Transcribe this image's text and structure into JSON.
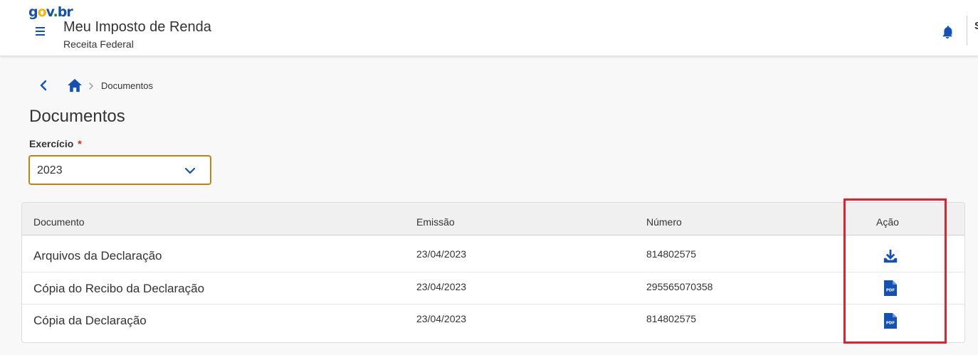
{
  "header": {
    "logo": {
      "g": "g",
      "o": "o",
      "v": "v",
      "dot": ".",
      "br": "br"
    },
    "title": "Meu Imposto de Renda",
    "subtitle": "Receita Federal",
    "cut_text": "S",
    "icons": {
      "menu": "hamburger-menu-icon",
      "notifications": "bell-icon"
    }
  },
  "breadcrumb": {
    "current": "Documentos",
    "icons": {
      "back": "chevron-left-icon",
      "home": "home-icon",
      "separator": "chevron-right-icon"
    }
  },
  "page": {
    "title": "Documentos"
  },
  "form": {
    "exercicio_label": "Exercício",
    "required_mark": "*",
    "exercicio_value": "2023"
  },
  "table": {
    "headers": [
      "Documento",
      "Emissão",
      "Número",
      "Ação"
    ],
    "rows": [
      {
        "documento": "Arquivos da Declaração",
        "emissao": "23/04/2023",
        "numero": "814802575",
        "acao_icon": "download-icon"
      },
      {
        "documento": "Cópia do Recibo da Declaração",
        "emissao": "23/04/2023",
        "numero": "295565070358",
        "acao_icon": "pdf-icon"
      },
      {
        "documento": "Cópia da Declaração",
        "emissao": "23/04/2023",
        "numero": "814802575",
        "acao_icon": "pdf-icon"
      }
    ]
  },
  "colors": {
    "primary_blue": "#1351b4",
    "select_border": "#c2850c",
    "highlight_red": "#e2232a",
    "required_red": "#e52207"
  }
}
